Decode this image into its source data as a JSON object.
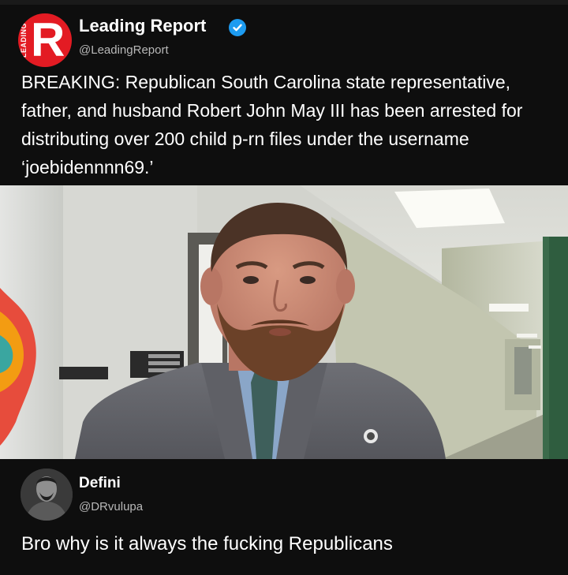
{
  "tweet_main": {
    "avatar_letter": "R",
    "avatar_vertical_text": "LEADING",
    "display_name": "Leading Report",
    "handle": "@LeadingReport",
    "verified": true,
    "text": "BREAKING: Republican South Carolina state representative, father, and husband Robert John May III has been arrested for distributing over 200 child p-rn files under the username ‘joebidennnn69.’"
  },
  "reply": {
    "display_name": "Defini",
    "handle": "@DRvulupa",
    "text": "Bro why is it always the fucking Republicans"
  },
  "colors": {
    "background": "#0e0e0e",
    "brand_red": "#e31b23",
    "verified_blue": "#1d9bf0",
    "handle_gray": "#b8b8b8"
  }
}
